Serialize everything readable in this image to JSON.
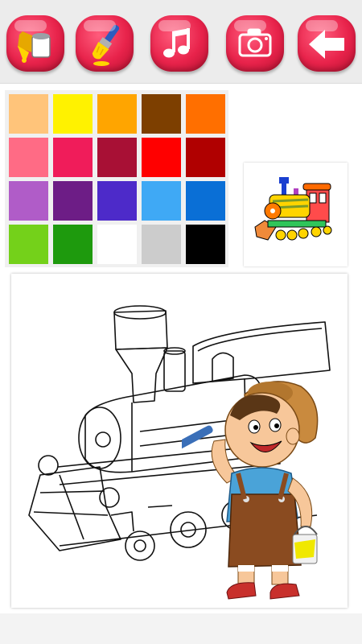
{
  "toolbar": {
    "buttons": [
      {
        "name": "fill-bucket",
        "icon": "paint-bucket-icon"
      },
      {
        "name": "brush",
        "icon": "paint-brush-icon"
      },
      {
        "name": "music",
        "icon": "music-note-icon"
      },
      {
        "name": "camera",
        "icon": "camera-icon"
      },
      {
        "name": "back",
        "icon": "arrow-left-icon"
      }
    ],
    "button_color": "#e8234b"
  },
  "palette": {
    "colors": [
      "#ffc47a",
      "#fff200",
      "#ffa500",
      "#7d3f00",
      "#ff6f00",
      "#ff6b85",
      "#f01c5a",
      "#a81035",
      "#ff0000",
      "#b00000",
      "#b05cc8",
      "#6d1d86",
      "#4d2ac9",
      "#3fa9f5",
      "#0a6fd6",
      "#74d11a",
      "#1e9a0d",
      "#ffffff",
      "#cccccc",
      "#000000"
    ]
  },
  "preview": {
    "icon": "colored-train-thumbnail"
  },
  "canvas": {
    "icon": "train-outline-drawing",
    "mascot": "boy-painter-mascot"
  }
}
